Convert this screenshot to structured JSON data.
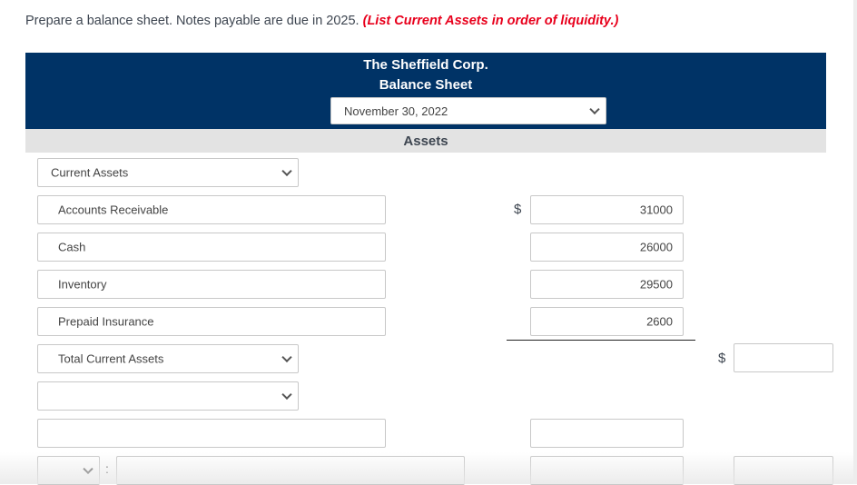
{
  "instructions": {
    "text": "Prepare a balance sheet. Notes payable are due in 2025.",
    "emphasis": "(List Current Assets in order of liquidity.)"
  },
  "header": {
    "company": "The Sheffield Corp.",
    "statement": "Balance Sheet",
    "date_selected": "November 30, 2022"
  },
  "section": {
    "title": "Assets"
  },
  "rows": [
    {
      "label": "Current Assets",
      "type": "select",
      "amount": ""
    },
    {
      "label": "Accounts Receivable",
      "type": "input",
      "amount": "31000",
      "currency": "$"
    },
    {
      "label": "Cash",
      "type": "input",
      "amount": "26000"
    },
    {
      "label": "Inventory",
      "type": "input",
      "amount": "29500"
    },
    {
      "label": "Prepaid Insurance",
      "type": "input",
      "amount": "2600"
    },
    {
      "label": "Total Current Assets",
      "type": "select",
      "total": "",
      "currency": "$"
    },
    {
      "label": "",
      "type": "select"
    },
    {
      "label": "",
      "type": "input",
      "amount": ""
    },
    {
      "label": "",
      "type": "select-with-input",
      "colon": ":",
      "amount": "",
      "total": ""
    }
  ],
  "colors": {
    "header_bg": "#003366",
    "section_bg": "#e3e3e3",
    "emphasis": "#e8001c"
  }
}
